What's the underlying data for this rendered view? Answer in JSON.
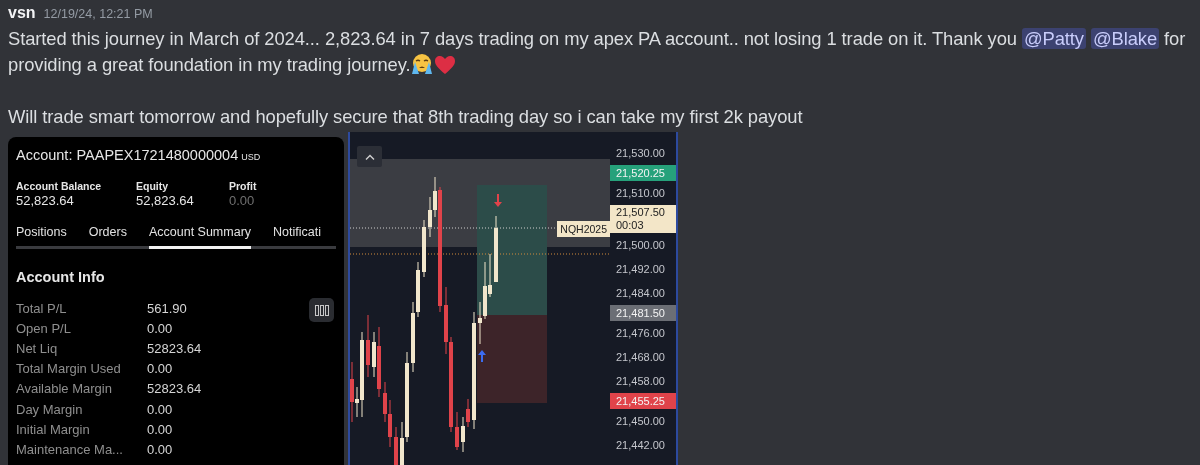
{
  "message": {
    "author": "vsn",
    "timestamp": "12/19/24, 12:21 PM",
    "paragraphs": [
      [
        {
          "kind": "text",
          "text": "Started this journey in March of 2024... 2,823.64 in 7 days trading on my apex PA account.. not losing 1 trade on it. Thank you "
        },
        {
          "kind": "mention",
          "text": "@Patty"
        },
        {
          "kind": "mention",
          "text": "@Blake"
        },
        {
          "kind": "text",
          "text": " for providing a great foundation in my trading journey."
        },
        {
          "kind": "cry"
        },
        {
          "kind": "heart"
        }
      ],
      [
        {
          "kind": "text",
          "text": "Will trade smart tomorrow and hopefully secure that 8th trading day so i can take my first 2k payout"
        }
      ]
    ]
  },
  "account_panel": {
    "account_label": "Account: PAAPEX1721480000004",
    "currency": "USD",
    "stats": [
      {
        "label": "Account Balance",
        "value": "52,823.64",
        "muted": false
      },
      {
        "label": "Equity",
        "value": "52,823.64",
        "muted": false
      },
      {
        "label": "Profit",
        "value": "0.00",
        "muted": true
      }
    ],
    "tabs": [
      {
        "label": "Positions",
        "selected": false
      },
      {
        "label": "Orders",
        "selected": false
      },
      {
        "label": "Account Summary",
        "selected": true
      },
      {
        "label": "Notificati",
        "selected": false
      }
    ],
    "section_title": "Account Info",
    "rows": [
      {
        "label": "Total P/L",
        "value": "561.90"
      },
      {
        "label": "Open P/L",
        "value": "0.00"
      },
      {
        "label": "Net Liq",
        "value": "52823.64"
      },
      {
        "label": "Total Margin Used",
        "value": "0.00"
      },
      {
        "label": "Available Margin",
        "value": "52823.64"
      },
      {
        "label": "Day Margin",
        "value": "0.00"
      },
      {
        "label": "Initial Margin",
        "value": "0.00"
      },
      {
        "label": "Maintenance Ma...",
        "value": "0.00"
      }
    ]
  },
  "chart_panel": {
    "symbol_label": "NQH2025",
    "axis": [
      {
        "kind": "tick",
        "text": "21,530.00"
      },
      {
        "kind": "badge",
        "text": "21,520.25",
        "color": "#26a17b"
      },
      {
        "kind": "tick",
        "text": "21,510.00"
      },
      {
        "kind": "price",
        "text": "21,507.50",
        "countdown": "00:03",
        "color": "#f3e6c8"
      },
      {
        "kind": "tick",
        "text": "21,500.00"
      },
      {
        "kind": "tick",
        "text": "21,492.00"
      },
      {
        "kind": "tick",
        "text": "21,484.00"
      },
      {
        "kind": "badge",
        "text": "21,481.50",
        "color": "#6b6e75"
      },
      {
        "kind": "tick",
        "text": "21,476.00"
      },
      {
        "kind": "tick",
        "text": "21,468.00"
      },
      {
        "kind": "tick",
        "text": "21,458.00"
      },
      {
        "kind": "badge",
        "text": "21,455.25",
        "color": "#e0434a"
      },
      {
        "kind": "tick",
        "text": "21,450.00"
      },
      {
        "kind": "tick",
        "text": "21,442.00"
      }
    ]
  }
}
